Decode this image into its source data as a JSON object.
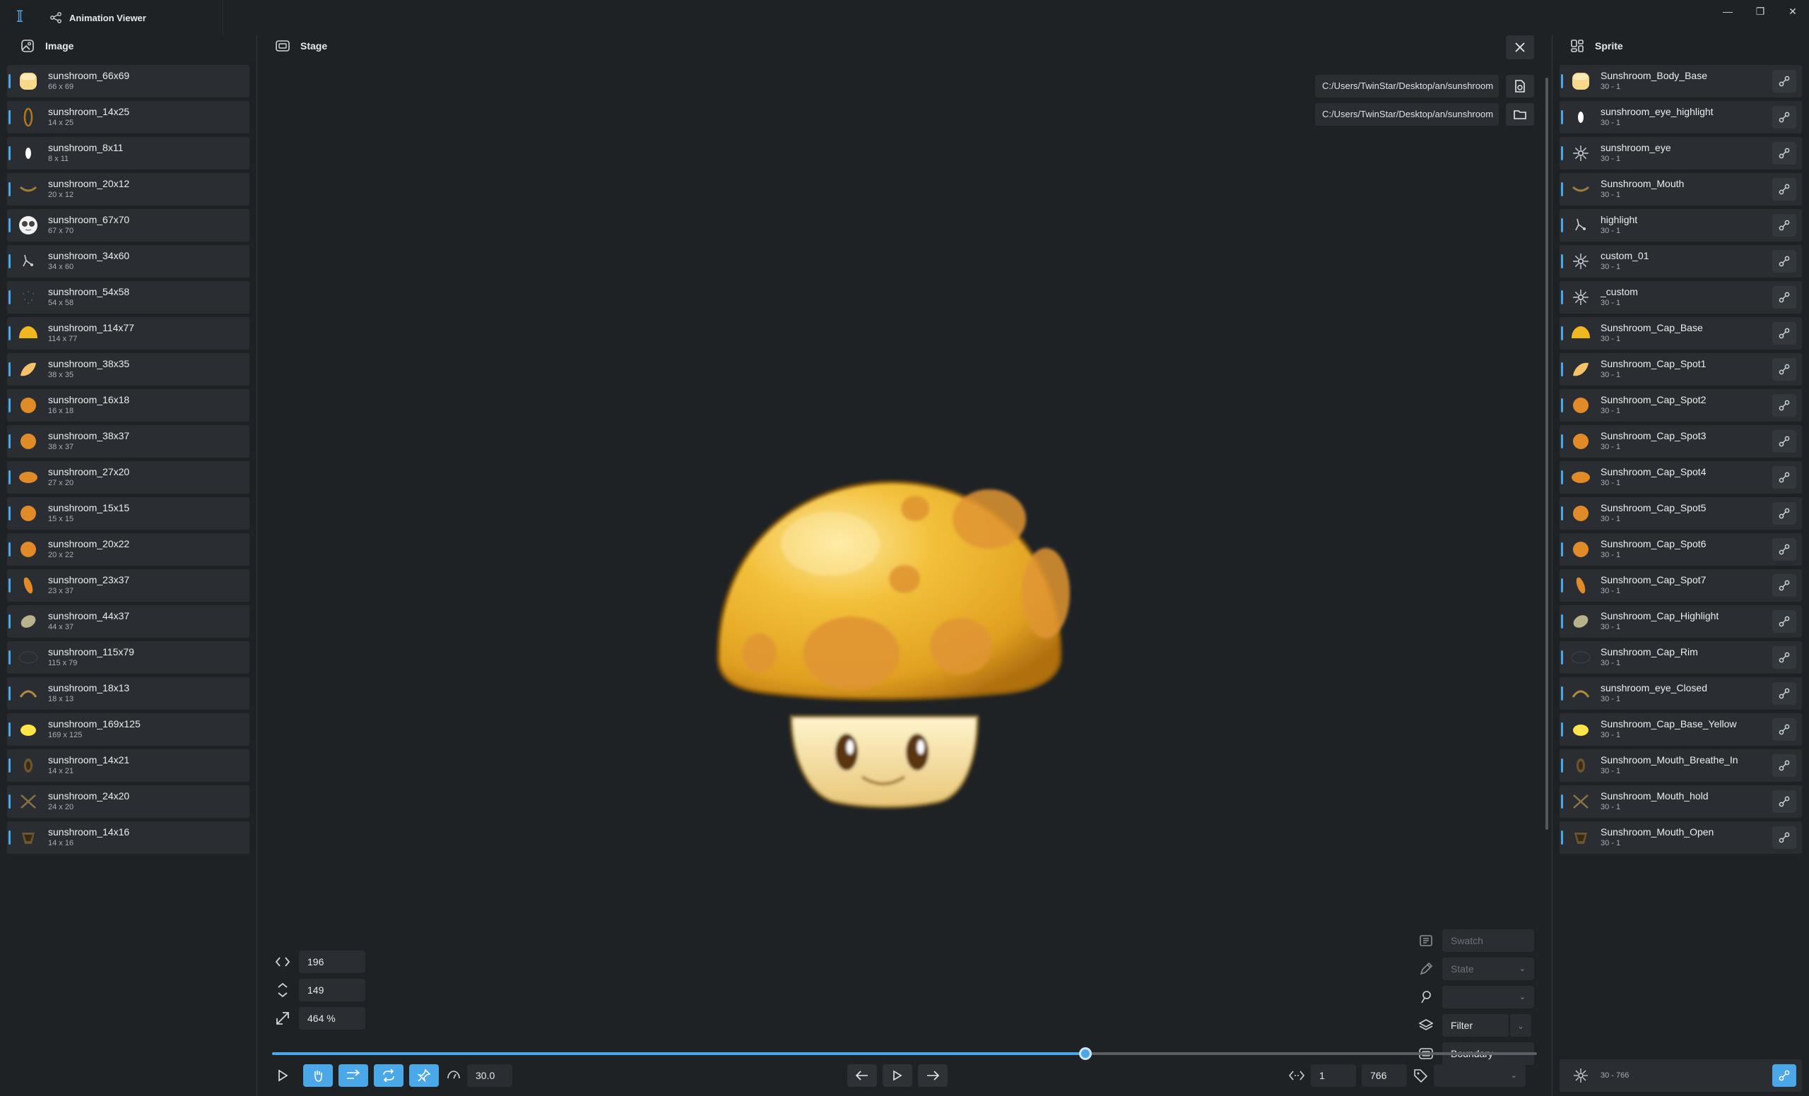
{
  "window": {
    "title": "Animation Viewer",
    "controls": [
      "minimize-icon",
      "restore-icon",
      "close-icon"
    ]
  },
  "left_panel": {
    "title": "Image",
    "items": [
      {
        "name": "sunshroom_66x69",
        "size": "66 x 69",
        "thumb": "body"
      },
      {
        "name": "sunshroom_14x25",
        "size": "14 x 25",
        "thumb": "ring"
      },
      {
        "name": "sunshroom_8x11",
        "size": "8 x 11",
        "thumb": "eyehl"
      },
      {
        "name": "sunshroom_20x12",
        "size": "20 x 12",
        "thumb": "mouth"
      },
      {
        "name": "sunshroom_67x70",
        "size": "67 x 70",
        "thumb": "face"
      },
      {
        "name": "sunshroom_34x60",
        "size": "34 x 60",
        "thumb": "sparkle"
      },
      {
        "name": "sunshroom_54x58",
        "size": "54 x 58",
        "thumb": "dots"
      },
      {
        "name": "sunshroom_114x77",
        "size": "114 x 77",
        "thumb": "cap"
      },
      {
        "name": "sunshroom_38x35",
        "size": "38 x 35",
        "thumb": "spot1"
      },
      {
        "name": "sunshroom_16x18",
        "size": "16 x 18",
        "thumb": "spot"
      },
      {
        "name": "sunshroom_38x37",
        "size": "38 x 37",
        "thumb": "spot"
      },
      {
        "name": "sunshroom_27x20",
        "size": "27 x 20",
        "thumb": "spotwide"
      },
      {
        "name": "sunshroom_15x15",
        "size": "15 x 15",
        "thumb": "spot"
      },
      {
        "name": "sunshroom_20x22",
        "size": "20 x 22",
        "thumb": "spot"
      },
      {
        "name": "sunshroom_23x37",
        "size": "23 x 37",
        "thumb": "spotthin"
      },
      {
        "name": "sunshroom_44x37",
        "size": "44 x 37",
        "thumb": "caphl"
      },
      {
        "name": "sunshroom_115x79",
        "size": "115 x 79",
        "thumb": "rim"
      },
      {
        "name": "sunshroom_18x13",
        "size": "18 x 13",
        "thumb": "eyeclosed"
      },
      {
        "name": "sunshroom_169x125",
        "size": "169 x 125",
        "thumb": "capyellow"
      },
      {
        "name": "sunshroom_14x21",
        "size": "14 x 21",
        "thumb": "mouthin"
      },
      {
        "name": "sunshroom_24x20",
        "size": "24 x 20",
        "thumb": "mouthhold"
      },
      {
        "name": "sunshroom_14x16",
        "size": "14 x 16",
        "thumb": "mouthopen"
      }
    ]
  },
  "stage": {
    "title": "Stage",
    "paths": [
      "C:/Users/TwinStar/Desktop/an/sunshroom",
      "C:/Users/TwinStar/Desktop/an/sunshroom"
    ],
    "position": {
      "x": "196",
      "y": "149",
      "zoom": "464 %"
    },
    "options": {
      "swatch_placeholder": "Swatch",
      "state_placeholder": "State",
      "plant_value": "",
      "filter_value": "Filter",
      "boundary_value": "Boundary"
    },
    "timeline_progress": 0.643,
    "speed": "30.0",
    "frame_start": "1",
    "frame_end": "766",
    "label_value": ""
  },
  "right_panel": {
    "title": "Sprite",
    "items": [
      {
        "name": "Sunshroom_Body_Base",
        "frames": "30 - 1",
        "thumb": "body"
      },
      {
        "name": "sunshroom_eye_highlight",
        "frames": "30 - 1",
        "thumb": "eyehl"
      },
      {
        "name": "sunshroom_eye",
        "frames": "30 - 1",
        "thumb": "node"
      },
      {
        "name": "Sunshroom_Mouth",
        "frames": "30 - 1",
        "thumb": "mouth"
      },
      {
        "name": "highlight",
        "frames": "30 - 1",
        "thumb": "sparkle"
      },
      {
        "name": "custom_01",
        "frames": "30 - 1",
        "thumb": "node"
      },
      {
        "name": "_custom",
        "frames": "30 - 1",
        "thumb": "node"
      },
      {
        "name": "Sunshroom_Cap_Base",
        "frames": "30 - 1",
        "thumb": "cap"
      },
      {
        "name": "Sunshroom_Cap_Spot1",
        "frames": "30 - 1",
        "thumb": "spot1"
      },
      {
        "name": "Sunshroom_Cap_Spot2",
        "frames": "30 - 1",
        "thumb": "spot"
      },
      {
        "name": "Sunshroom_Cap_Spot3",
        "frames": "30 - 1",
        "thumb": "spot"
      },
      {
        "name": "Sunshroom_Cap_Spot4",
        "frames": "30 - 1",
        "thumb": "spotwide"
      },
      {
        "name": "Sunshroom_Cap_Spot5",
        "frames": "30 - 1",
        "thumb": "spot"
      },
      {
        "name": "Sunshroom_Cap_Spot6",
        "frames": "30 - 1",
        "thumb": "spot"
      },
      {
        "name": "Sunshroom_Cap_Spot7",
        "frames": "30 - 1",
        "thumb": "spotthin"
      },
      {
        "name": "Sunshroom_Cap_Highlight",
        "frames": "30 - 1",
        "thumb": "caphl"
      },
      {
        "name": "Sunshroom_Cap_Rim",
        "frames": "30 - 1",
        "thumb": "rim"
      },
      {
        "name": "sunshroom_eye_Closed",
        "frames": "30 - 1",
        "thumb": "eyeclosed"
      },
      {
        "name": "Sunshroom_Cap_Base_Yellow",
        "frames": "30 - 1",
        "thumb": "capyellow"
      },
      {
        "name": "Sunshroom_Mouth_Breathe_In",
        "frames": "30 - 1",
        "thumb": "mouthin"
      },
      {
        "name": "Sunshroom_Mouth_hold",
        "frames": "30 - 1",
        "thumb": "mouthhold"
      },
      {
        "name": "Sunshroom_Mouth_Open",
        "frames": "30 - 1",
        "thumb": "mouthopen"
      }
    ],
    "footer_frames": "30 - 766"
  },
  "colors": {
    "accent": "#4aa8e8",
    "background": "#1f2225",
    "item": "#2a2e32"
  }
}
